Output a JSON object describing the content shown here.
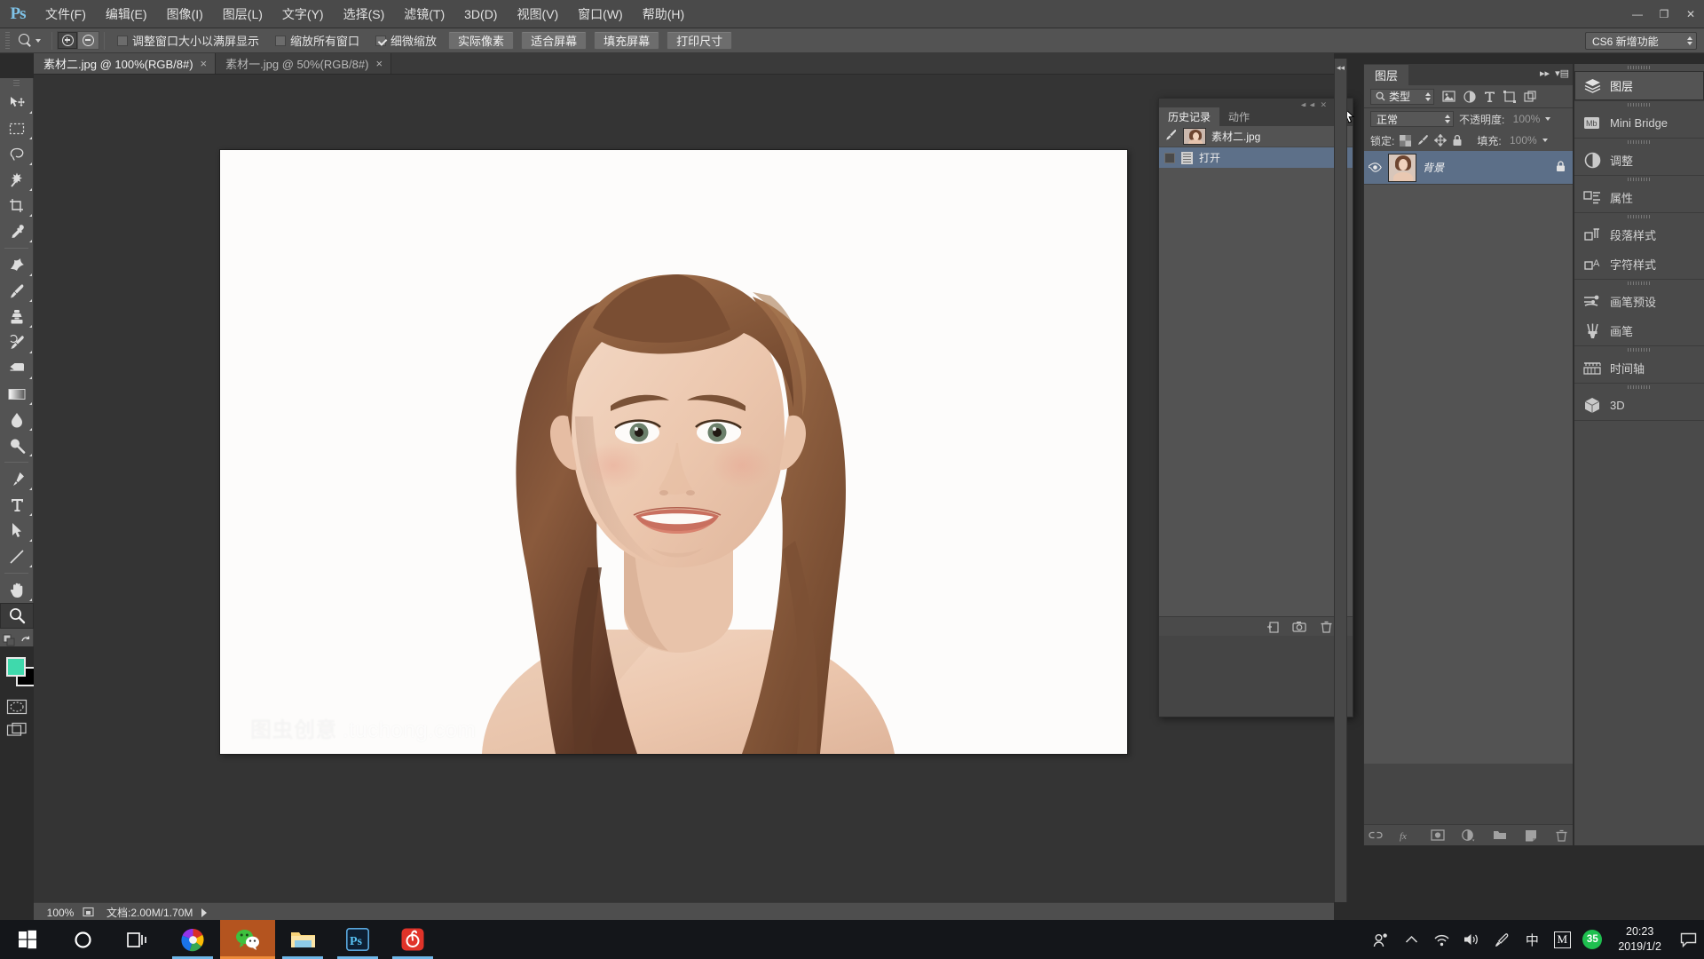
{
  "app": {
    "name": "Photoshop CS6",
    "logo_text": "Ps",
    "workspace": "CS6 新增功能"
  },
  "menubar": {
    "items": [
      {
        "label": "文件(F)"
      },
      {
        "label": "编辑(E)"
      },
      {
        "label": "图像(I)"
      },
      {
        "label": "图层(L)"
      },
      {
        "label": "文字(Y)"
      },
      {
        "label": "选择(S)"
      },
      {
        "label": "滤镜(T)"
      },
      {
        "label": "3D(D)"
      },
      {
        "label": "视图(V)"
      },
      {
        "label": "窗口(W)"
      },
      {
        "label": "帮助(H)"
      }
    ],
    "window_buttons": {
      "minimize": "—",
      "maximize": "❐",
      "close": "✕"
    }
  },
  "options_bar": {
    "tool_icon": "zoom-tool-icon",
    "zoom_in_label": "zoom-in",
    "zoom_out_label": "zoom-out",
    "checkbox_resize_windows": {
      "label": "调整窗口大小以满屏显示",
      "checked": false
    },
    "checkbox_zoom_all_windows": {
      "label": "缩放所有窗口",
      "checked": false
    },
    "checkbox_scrubby_zoom": {
      "label": "细微缩放",
      "checked": true
    },
    "buttons": [
      {
        "label": "实际像素"
      },
      {
        "label": "适合屏幕"
      },
      {
        "label": "填充屏幕"
      },
      {
        "label": "打印尺寸"
      }
    ]
  },
  "tabs": [
    {
      "label": "素材二.jpg @ 100%(RGB/8#)",
      "active": true,
      "close": "×"
    },
    {
      "label": "素材一.jpg @ 50%(RGB/8#)",
      "active": false,
      "close": "×"
    }
  ],
  "toolbar": {
    "tools": [
      {
        "name": "move-tool",
        "active": false
      },
      {
        "name": "rectangular-marquee-tool",
        "active": false
      },
      {
        "name": "lasso-tool",
        "active": false
      },
      {
        "name": "magic-wand-tool",
        "active": false
      },
      {
        "name": "crop-tool",
        "active": false
      },
      {
        "name": "eyedropper-tool",
        "active": false
      },
      {
        "name": "spot-healing-brush-tool",
        "active": false
      },
      {
        "name": "brush-tool",
        "active": false
      },
      {
        "name": "clone-stamp-tool",
        "active": false
      },
      {
        "name": "history-brush-tool",
        "active": false
      },
      {
        "name": "eraser-tool",
        "active": false
      },
      {
        "name": "gradient-tool",
        "active": false
      },
      {
        "name": "blur-tool",
        "active": false
      },
      {
        "name": "dodge-tool",
        "active": false
      },
      {
        "name": "pen-tool",
        "active": false
      },
      {
        "name": "horizontal-type-tool",
        "active": false
      },
      {
        "name": "path-selection-tool",
        "active": false
      },
      {
        "name": "line-tool",
        "active": false
      },
      {
        "name": "hand-tool",
        "active": false
      },
      {
        "name": "zoom-tool",
        "active": true
      }
    ],
    "foreground_color": "#3fd9ac",
    "background_color": "#000000",
    "quick_mask": "quick-mask-mode",
    "screen_mode": "screen-mode"
  },
  "canvas": {
    "document_name": "素材二.jpg",
    "watermark_cn": "图虫创意",
    "watermark_url": ".tuchong.com"
  },
  "history_panel": {
    "tabs": [
      {
        "label": "历史记录",
        "active": true
      },
      {
        "label": "动作",
        "active": false
      }
    ],
    "snapshot": {
      "label": "素材二.jpg"
    },
    "states": [
      {
        "label": "打开",
        "selected": true
      }
    ],
    "footer_icons": [
      "new-document-from-state-icon",
      "new-snapshot-icon",
      "delete-state-icon"
    ],
    "menu_icon": "panel-menu-icon"
  },
  "layers_panel": {
    "tab_label": "图层",
    "filter": {
      "label": "类型",
      "icons": [
        "pixel-filter-icon",
        "adjustment-filter-icon",
        "type-filter-icon",
        "shape-filter-icon",
        "smart-object-filter-icon"
      ]
    },
    "blend_mode": "正常",
    "opacity_label": "不透明度:",
    "opacity_value": "100%",
    "lock_label": "锁定:",
    "lock_icons": [
      "lock-transparent-pixels-icon",
      "lock-image-pixels-icon",
      "lock-position-icon",
      "lock-all-icon"
    ],
    "fill_label": "填充:",
    "fill_value": "100%",
    "layers": [
      {
        "name": "背景",
        "visible": true,
        "locked": true,
        "selected": true
      }
    ],
    "footer_icons": [
      "link-layers-icon",
      "layer-style-fx-icon",
      "add-layer-mask-icon",
      "new-adjustment-layer-icon",
      "new-group-icon",
      "new-layer-icon",
      "delete-layer-icon"
    ]
  },
  "dock": {
    "groups": [
      {
        "items": [
          {
            "label": "图层",
            "icon": "layers-icon",
            "active": true
          }
        ]
      },
      {
        "items": [
          {
            "label": "Mini Bridge",
            "icon": "mini-bridge-icon",
            "active": false
          }
        ]
      },
      {
        "items": [
          {
            "label": "调整",
            "icon": "adjustments-icon",
            "active": false
          }
        ]
      },
      {
        "items": [
          {
            "label": "属性",
            "icon": "properties-icon",
            "active": false
          }
        ]
      },
      {
        "items": [
          {
            "label": "段落样式",
            "icon": "paragraph-styles-icon",
            "active": false
          },
          {
            "label": "字符样式",
            "icon": "character-styles-icon",
            "active": false
          }
        ]
      },
      {
        "items": [
          {
            "label": "画笔预设",
            "icon": "brush-presets-icon",
            "active": false
          },
          {
            "label": "画笔",
            "icon": "brush-icon",
            "active": false
          }
        ]
      },
      {
        "items": [
          {
            "label": "时间轴",
            "icon": "timeline-icon",
            "active": false
          }
        ]
      },
      {
        "items": [
          {
            "label": "3D",
            "icon": "cube-3d-icon",
            "active": false
          }
        ]
      }
    ]
  },
  "statusbar": {
    "zoom": "100%",
    "doc_info": "文档:2.00M/1.70M",
    "arrow_icon": "status-expand-arrow-icon"
  },
  "taskbar": {
    "items": [
      {
        "name": "start-button",
        "icon": "windows-logo-icon"
      },
      {
        "name": "cortana-button",
        "icon": "cortana-circle-icon"
      },
      {
        "name": "task-view-button",
        "icon": "task-view-icon"
      },
      {
        "name": "browser-taskbar-item",
        "icon": "chrome-browser-icon",
        "state": "running"
      },
      {
        "name": "wechat-taskbar-item",
        "icon": "wechat-icon",
        "state": "active"
      },
      {
        "name": "file-explorer-taskbar-item",
        "icon": "folder-icon",
        "state": "running"
      },
      {
        "name": "photoshop-taskbar-item",
        "icon": "photoshop-icon",
        "state": "running"
      },
      {
        "name": "netease-music-taskbar-item",
        "icon": "netease-music-icon",
        "state": "running"
      }
    ],
    "tray": [
      {
        "name": "people-icon",
        "glyph": "people"
      },
      {
        "name": "show-hidden-icons-chevron",
        "glyph": "^"
      },
      {
        "name": "wifi-icon",
        "glyph": "wifi"
      },
      {
        "name": "volume-icon",
        "glyph": "volume"
      },
      {
        "name": "pen-tool-tray-icon",
        "glyph": "pen"
      },
      {
        "name": "ime-chinese-icon",
        "glyph": "中"
      },
      {
        "name": "ime-mode-icon",
        "glyph": "M"
      },
      {
        "name": "battery-badge-icon",
        "glyph": "35"
      }
    ],
    "clock": {
      "time": "20:23",
      "date": "2019/1/2"
    },
    "notification_icon": "action-center-icon"
  }
}
